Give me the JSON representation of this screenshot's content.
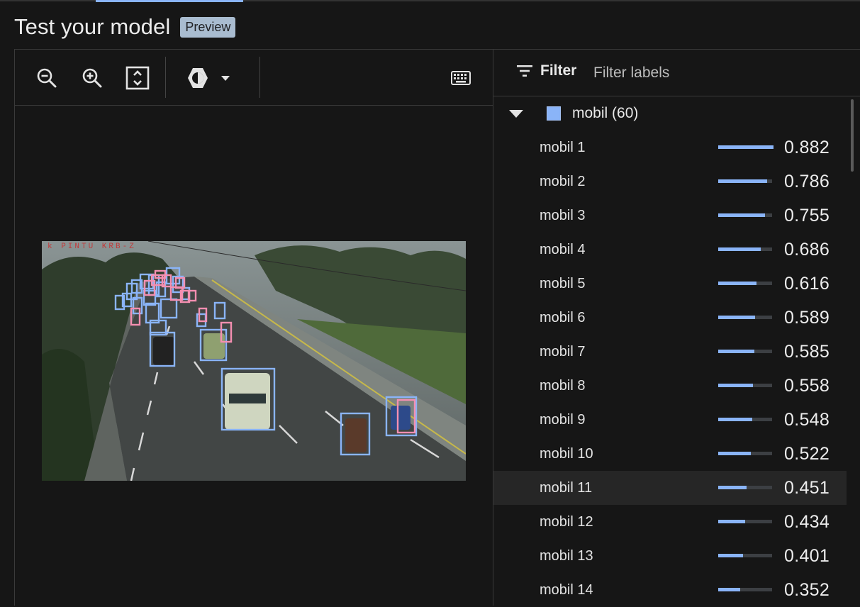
{
  "header": {
    "title": "Test your model",
    "badge": "Preview"
  },
  "toolbar": {
    "buttons": [
      {
        "icon": "zoom-out-icon"
      },
      {
        "icon": "zoom-in-icon"
      },
      {
        "icon": "fit-to-screen-icon"
      },
      {
        "icon": "brightness-icon"
      },
      {
        "icon": "dropdown-arrow-icon"
      },
      {
        "icon": "keyboard-icon"
      }
    ]
  },
  "image": {
    "watermark": "k PINTU KRB-Z",
    "box_colors": {
      "mobil": "#8ab4f8",
      "other": "#f48fb1"
    }
  },
  "filter": {
    "label": "Filter",
    "placeholder": "Filter labels"
  },
  "group": {
    "label": "mobil (60)",
    "color": "#8ab4f8",
    "expanded": true
  },
  "items": [
    {
      "label": "mobil 1",
      "score": "0.882",
      "value": 0.882
    },
    {
      "label": "mobil 2",
      "score": "0.786",
      "value": 0.786
    },
    {
      "label": "mobil 3",
      "score": "0.755",
      "value": 0.755
    },
    {
      "label": "mobil 4",
      "score": "0.686",
      "value": 0.686
    },
    {
      "label": "mobil 5",
      "score": "0.616",
      "value": 0.616
    },
    {
      "label": "mobil 6",
      "score": "0.589",
      "value": 0.589
    },
    {
      "label": "mobil 7",
      "score": "0.585",
      "value": 0.585
    },
    {
      "label": "mobil 8",
      "score": "0.558",
      "value": 0.558
    },
    {
      "label": "mobil 9",
      "score": "0.548",
      "value": 0.548
    },
    {
      "label": "mobil 10",
      "score": "0.522",
      "value": 0.522
    },
    {
      "label": "mobil 11",
      "score": "0.451",
      "value": 0.451,
      "selected": true
    },
    {
      "label": "mobil 12",
      "score": "0.434",
      "value": 0.434
    },
    {
      "label": "mobil 13",
      "score": "0.401",
      "value": 0.401
    },
    {
      "label": "mobil 14",
      "score": "0.352",
      "value": 0.352
    }
  ],
  "colors": {
    "accent": "#8ab4f8",
    "background": "#161616",
    "selected_row": "#262626"
  }
}
